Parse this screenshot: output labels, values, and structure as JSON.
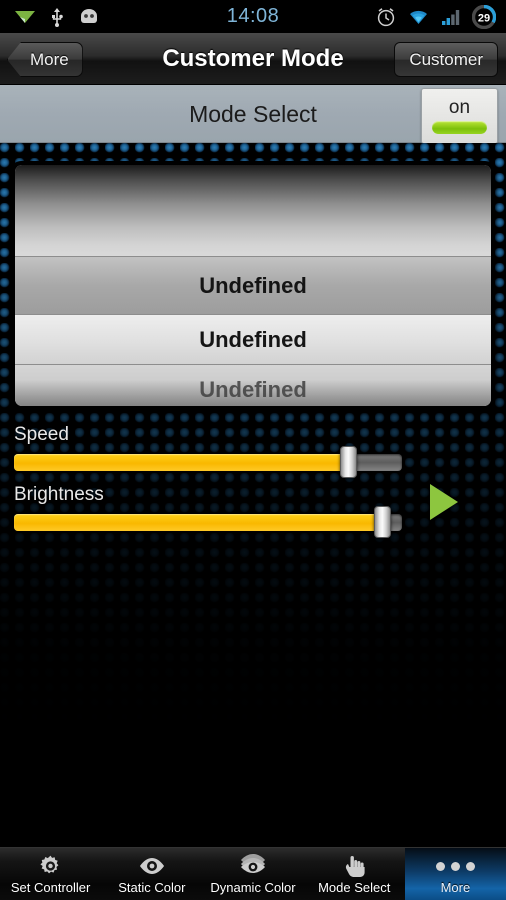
{
  "status_bar": {
    "time": "14:08",
    "battery_percent": "29",
    "left_icons": [
      "location-arrow-icon",
      "usb-icon",
      "android-robot-icon"
    ],
    "right_icons": [
      "alarm-clock-icon",
      "wifi-icon",
      "cellular-signal-icon",
      "battery-icon"
    ]
  },
  "title_bar": {
    "back_label": "More",
    "title": "Customer Mode",
    "right_label": "Customer"
  },
  "subheader": {
    "title": "Mode Select",
    "toggle_label": "on",
    "toggle_state": "on",
    "toggle_color": "#8cd41c"
  },
  "picker": {
    "items": [
      {
        "label": "Undefined",
        "state": "selected"
      },
      {
        "label": "Undefined",
        "state": "normal"
      },
      {
        "label": "Undefined",
        "state": "dimmed"
      }
    ]
  },
  "controls": {
    "speed": {
      "label": "Speed",
      "percent": 88
    },
    "brightness": {
      "label": "Brightness",
      "percent": 97
    },
    "play_button": "play-triangle-icon",
    "accent_color": "#f9b800",
    "play_color": "#8dc63f"
  },
  "tabbar": {
    "items": [
      {
        "label": "Set Controller",
        "icon": "gear-icon",
        "selected": false
      },
      {
        "label": "Static Color",
        "icon": "eye-icon",
        "selected": false
      },
      {
        "label": "Dynamic Color",
        "icon": "layered-eye-icon",
        "selected": false
      },
      {
        "label": "Mode Select",
        "icon": "hand-touch-icon",
        "selected": false
      },
      {
        "label": "More",
        "icon": "three-dots-icon",
        "selected": true
      }
    ]
  }
}
